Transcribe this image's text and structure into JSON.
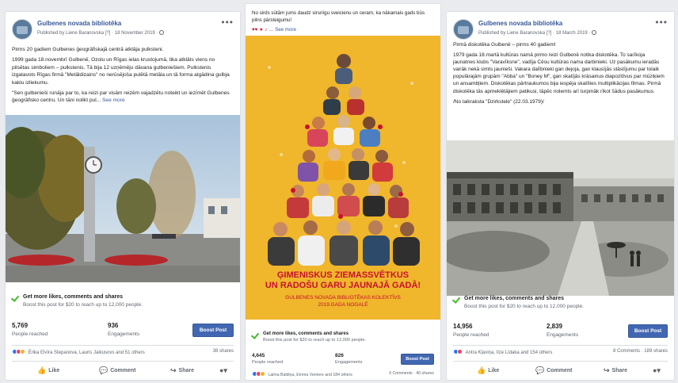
{
  "posts": [
    {
      "page_name": "Gulbenes novada bibliotēka",
      "meta": "Published by Liene Baranovska [?] · 18 November 2019 ·",
      "paragraphs": [
        "Pirms 20 gadiem Gulbenes ģeogrāfiskajā centrā atklāja pulksteni.",
        "1999 gada 18.novembrī Gulbenē, Ozolu un Rīgas ielas krustojumā, tika atklāts viens no pilsētas simboliem – pulkstenis. Tā bija 12 uzņēmēju dāvana gulbeniešiem. Pulkstenis izgatavots Rīgas firmā \"Metāldizains\" no nerūsējoša pulētā metāla un tā forma atgādina gulbja kaklu izliekumu.",
        "\"Sen gulbenieši runāja par to, ka reizi par visām reizēm vajadzētu noteikt un iezīmēt Gulbenes ģeogrāfisko centru. Un tāni nolikt pul..."
      ],
      "see_more": "See more",
      "boost_title": "Get more likes, comments and shares",
      "boost_sub": "Boost this post for $20 to reach up to 12,000 people.",
      "reached": "5,769",
      "reached_label": "People reached",
      "engagements": "936",
      "engagements_label": "Engagements",
      "boost_button": "Boost Post",
      "reactions": "Ērika Elvīra Stepanova, Lauris Jaikusovs and 51 others",
      "shares": "38 shares",
      "actions": {
        "like": "Like",
        "comment": "Comment",
        "share": "Share"
      }
    },
    {
      "paragraphs": [
        "No sirds sūtām jums daudz sirsnīgu sveicienu un ceram, ka nākamais gads būs pilns pārsteigumu!"
      ],
      "see_more": "See more",
      "poster_line1": "ĢIMENISKUS ZIEMASSVĒTKUS",
      "poster_line2": "UN RADOŠU GARU JAUNAJĀ GADĀ!",
      "poster_line3": "GULBENES NOVADA BIBLIOTĒKAS KOLEKTĪVS",
      "poster_line4": "2019.GADA NOGALĒ",
      "boost_title": "Get more likes, comments and shares",
      "boost_sub": "Boost this post for $20 to reach up to 12,000 people.",
      "reached": "4,645",
      "reached_label": "People reached",
      "engagements": "826",
      "engagements_label": "Engagements",
      "boost_button": "Boost Post",
      "reactions": "Laima Baldiņa, Emma Vernere and 184 others",
      "shares": "6 Comments · 40 shares"
    },
    {
      "page_name": "Gulbenes novada bibliotēka",
      "meta": "Published by Liene Baranovska [?] · 18 March 2019 ·",
      "paragraphs": [
        "Pirmā diskotēka Gulbenē – pirms 40 gadiem!",
        "1979 gada 18.martā kultūras namā pirmo reizi Gulbenē notika diskotēka. To sarīkoja jaunatnes klubs \"Varavīksne\", vadīja Cēsu kultūras nama darbinieki. Uz pasākumu ieradās vairāk nekā simts jaunieši. Vakara dalībnieki gan dejoja, gan klausījās stāstījumu par tolaik populārajām grupām \"Abba\" un \"Boney M\", gan skatījās krāsainus diapozitīvus par mūziķiem un ansambļiem. Diskotēkas pārtraukumos bija iespēja skatīties multiplikācijas filmas. Pirmā diskotēka tās apmeklētājiem patikusi, tāpēc nolemts arī turpmāk rīkot šādus pasākumus.",
        "/No laikraksta \"Dzirkstele\" (22.03.1979)/"
      ],
      "boost_title": "Get more likes, comments and shares",
      "boost_sub": "Boost this post for $20 to reach up to 12,000 people.",
      "reached": "14,956",
      "reached_label": "People reached",
      "engagements": "2,839",
      "engagements_label": "Engagements",
      "boost_button": "Boost Post",
      "reactions": "Antra Kļaviņa, Ilze Līdaka and 154 others",
      "shares": "8 Comments · 189 shares",
      "actions": {
        "like": "Like",
        "comment": "Comment",
        "share": "Share"
      }
    }
  ],
  "colors": {
    "brand": "#4267b2",
    "link": "#385898",
    "check": "#42b72a",
    "poster_bg": "#f0b62c",
    "poster_text": "#c8102e"
  },
  "icons": [
    "globe-icon",
    "more-icon",
    "check-icon",
    "like-icon",
    "comment-icon",
    "share-icon",
    "audience-icon"
  ]
}
